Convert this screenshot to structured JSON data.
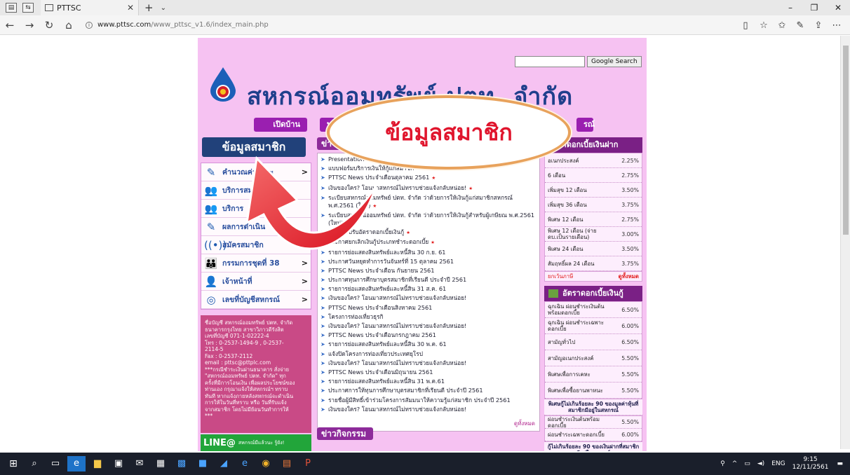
{
  "browser": {
    "tab_title": "PTTSC",
    "url_host": "www.pttsc.com",
    "url_path": "/www_pttsc_v1.6/index_main.php"
  },
  "page": {
    "search_button": "Google Search",
    "coop_name": "สหกรณ์ออมทรัพย์ ปตท. จำกัด",
    "menu": [
      "เปิดบ้าน",
      "บ",
      "รณ์"
    ],
    "left": {
      "heading": "ข้อมูลสมาชิก",
      "items": [
        {
          "label": "คำนวณค่าชำระ",
          "icon": "pencil-icon",
          "arrow": true
        },
        {
          "label": "บริการสมาชิก",
          "icon": "people-icon",
          "arrow": false
        },
        {
          "label": "บริการ",
          "icon": "people-icon",
          "arrow": false
        },
        {
          "label": "ผลการดำเนิน",
          "icon": "pencil-icon",
          "arrow": false
        },
        {
          "label": "สมัครสมาชิก",
          "icon": "signal-icon",
          "arrow": false
        },
        {
          "label": "กรรมการชุดที่ 38",
          "icon": "group-icon",
          "arrow": true
        },
        {
          "label": "เจ้าหน้าที่",
          "icon": "staff-icon",
          "arrow": true
        },
        {
          "label": "เลขที่บัญชีสหกรณ์",
          "icon": "target-icon",
          "arrow": true
        }
      ],
      "contact_lines": [
        "ชื่อบัญชี สหกรณ์ออมทรัพย์ ปตท. จำกัด",
        "ธนาคารกรุงไทย สาขาวิภาวดีรังสิต",
        "เลขที่บัญชี 071-1-02222-4",
        "โทร : 0-2537-1494-9 , 0-2537-",
        "2114-5",
        "Fax : 0-2537-2112",
        "email : pttsc@pttplc.com",
        "***กรณีชำระเงินผ่านธนาคาร สั่งจ่าย",
        "\"สหกรณ์ออมทรัพย์ ปตท. จำกัด\" ทุก",
        "ครั้งที่มีการโอนเงิน เพื่อผลประโยชน์ของ",
        "ท่านเอง กรุณาแจ้งให้สหกรณ์ฯ ทราบ",
        "ทันที หากแจ้งภายหลังสหกรณ์จะดำเนิน",
        "การให้ในวันที่ทราบ หรือ วันที่รับแจ้ง",
        "จากสมาชิก โดยไม่มีย้อนวันทำการให้",
        "***"
      ],
      "line_label": "LINE@",
      "line_sub": "สหกรณ์มีแล้วนะ รู้ยัง!"
    },
    "news": {
      "heading": "ข่าว",
      "items": [
        {
          "text": "Presentation",
          "new": false
        },
        {
          "text": "แบบฟอร์มบริการเงินให้กู้แก่สมาชิก",
          "new": false
        },
        {
          "text": "PTTSC News ประจำเดือนตุลาคม 2561",
          "new": true
        },
        {
          "text": "เงินของใคร? โอนมาสหกรณ์ไม่ทราบช่วยแจ้งกลับหน่อย!",
          "new": true
        },
        {
          "text": "ระเบียบสหกรณ์ออมทรัพย์ ปตท. จำกัด ว่าด้วยการให้เงินกู้แก่สมาชิกสหกรณ์ พ.ศ.2561 (ใหม่)",
          "new": true
        },
        {
          "text": "ระเบียบสหกรณ์ออมทรัพย์ ปตท. จำกัด ว่าด้วยการให้เงินกู้สำหรับผู้เกษียณ พ.ศ.2561 (ใหม่)",
          "new": false
        },
        {
          "text": "ประกาศปรับอัตราดอกเบี้ยเงินกู้",
          "new": true
        },
        {
          "text": "ประกาศยกเลิกเงินกู้ประเภทชำระดอกเบี้ย",
          "new": true
        },
        {
          "text": "รายการย่อแสดงสินทรัพย์และหนี้สิน 30 ก.ย. 61",
          "new": false
        },
        {
          "text": "ประกาศวันหยุดทำการวันจันทร์ที่ 15 ตุลาคม 2561",
          "new": false
        },
        {
          "text": "PTTSC News ประจำเดือน กันยายน 2561",
          "new": false
        },
        {
          "text": "ประกาศทุนการศึกษาบุตรสมาชิกที่เรียนดี ประจำปี 2561",
          "new": false
        },
        {
          "text": "รายการย่อแสดงสินทรัพย์และหนี้สิน 31 ส.ค. 61",
          "new": false
        },
        {
          "text": "เงินของใคร? โอนมาสหกรณ์ไม่ทราบช่วยแจ้งกลับหน่อย!",
          "new": false
        },
        {
          "text": "PTTSC News ประจำเดือนสิงหาคม 2561",
          "new": false
        },
        {
          "text": "โครงการท่องเที่ยวธุรกิ",
          "new": false
        },
        {
          "text": "เงินของใคร? โอนมาสหกรณ์ไม่ทราบช่วยแจ้งกลับหน่อย!",
          "new": false
        },
        {
          "text": "PTTSC News ประจำเดือนกรกฎาคม 2561",
          "new": false
        },
        {
          "text": "รายการย่อแสดงสินทรัพย์และหนี้สิน 30 พ.ค. 61",
          "new": false
        },
        {
          "text": "แจ้งปิดโครงการท่องเที่ยวประเทศยุโรป",
          "new": false
        },
        {
          "text": "เงินของใคร? โอนมาสหกรณ์ไม่ทราบช่วยแจ้งกลับหน่อย!",
          "new": false
        },
        {
          "text": "PTTSC News ประจำเดือนมิถุนายน 2561",
          "new": false
        },
        {
          "text": "รายการย่อแสดงสินทรัพย์และหนี้สิน 31 พ.ค.61",
          "new": false
        },
        {
          "text": "ประกาศการให้ทุนการศึกษาบุตรสมาชิกที่เรียนดี ประจำปี 2561",
          "new": false
        },
        {
          "text": "รายชื่อผู้มีสิทธิ์เข้าร่วมโครงการสัมมนาให้ความรู้แก่สมาชิก ประจำปี 2561",
          "new": false
        },
        {
          "text": "เงินของใคร? โอนมาสหกรณ์ไม่ทราบช่วยแจ้งกลับหน่อย!",
          "new": false
        }
      ],
      "more": "ดูทั้งหมด",
      "activity_heading": "ข่าวกิจกรรม"
    },
    "deposit": {
      "heading": "อัตราดอกเบี้ยเงินฝาก",
      "rows": [
        {
          "label": "อเนกประสงค์",
          "rate": "2.25%"
        },
        {
          "label": "6 เดือน",
          "rate": "2.75%"
        },
        {
          "label": "เพิ่มสุข 12 เดือน",
          "rate": "3.50%"
        },
        {
          "label": "เพิ่มสุข 36 เดือน",
          "rate": "3.75%"
        },
        {
          "label": "พิเศษ 12 เดือน",
          "rate": "2.75%"
        },
        {
          "label": "พิเศษ 12 เดือน (จ่าย ดบ.เป็นรายเดือน)",
          "rate": "3.00%"
        },
        {
          "label": "พิเศษ 24 เดือน",
          "rate": "3.50%"
        },
        {
          "label": "สัมฤทธิ์ผล 24 เดือน",
          "rate": "3.75%"
        }
      ],
      "tax_label": "ยกเว้นภาษี",
      "tax_more": "ดูทั้งหมด"
    },
    "loan": {
      "heading": "อัตราดอกเบี้ยเงินกู้",
      "rows": [
        {
          "label": "ฉุกเฉิน ผ่อนชำระเงินต้นพร้อมดอกเบี้ย",
          "rate": "6.50%"
        },
        {
          "label": "ฉุกเฉิน ผ่อนชำระเฉพาะดอกเบี้ย",
          "rate": "6.00%"
        },
        {
          "label": "สามัญทั่วไป",
          "rate": "6.50%"
        },
        {
          "label": "สามัญอเนกประสงค์",
          "rate": "5.50%"
        },
        {
          "label": "พิเศษเพื่อการเคหะ",
          "rate": "5.50%"
        },
        {
          "label": "พิเศษเพื่อซื้อยานพาหนะ",
          "rate": "5.50%"
        }
      ],
      "note1": "พิเศษกู้ไม่เกินร้อยละ 90 ของมูลค่าหุ้นที่สมาชิกมีอยู่ในสหกรณ์",
      "rows2": [
        {
          "label": "ผ่อนชำระเงินต้นพร้อมดอกเบี้ย",
          "rate": "5.50%"
        },
        {
          "label": "ผ่อนชำระเฉพาะดอกเบี้ย",
          "rate": "6.00%"
        }
      ],
      "note2": "กู้ไม่เกินร้อยละ 90 ของเงินฝากที่สมาชิกมีอยู่ในสหกรณ์",
      "rows3": [
        {
          "label": "ผ่อนชำระเงินต้นพร้อมดอกเบี้ย",
          "rate": "5.50%"
        }
      ]
    }
  },
  "overlay": {
    "callout": "ข้อมูลสมาชิก",
    "color": "#e0152d"
  },
  "taskbar": {
    "lang": "ENG",
    "time": "9:15",
    "date": "12/11/2561"
  }
}
